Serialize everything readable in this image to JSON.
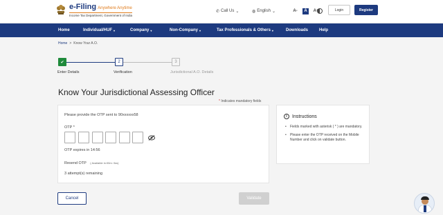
{
  "header": {
    "logo_main": "e-Filing",
    "logo_hindi": "Anywhere Anytime",
    "logo_sub": "Income Tax Department, Government of India",
    "call_us": "Call Us",
    "language": "English",
    "font_sizes": [
      "A-",
      "A",
      "A+"
    ],
    "login_label": "Login",
    "register_label": "Register",
    "brand_color": "#1d3a7f"
  },
  "nav": {
    "items": [
      {
        "label": "Home",
        "dropdown": false
      },
      {
        "label": "Individual/HUF",
        "dropdown": true
      },
      {
        "label": "Company",
        "dropdown": true
      },
      {
        "label": "Non-Company",
        "dropdown": true
      },
      {
        "label": "Tax Professionals & Others",
        "dropdown": true
      },
      {
        "label": "Downloads",
        "dropdown": false
      },
      {
        "label": "Help",
        "dropdown": false
      }
    ]
  },
  "breadcrumb": {
    "home": "Home",
    "separator": ">",
    "current": "Know Your A.O."
  },
  "stepper": {
    "steps": [
      {
        "number": "1",
        "label": "Enter Details",
        "state": "done"
      },
      {
        "number": "2",
        "label": "Verification",
        "state": "active"
      },
      {
        "number": "3",
        "label": "Jurisdictional A.O. Details",
        "state": "pending"
      }
    ]
  },
  "page": {
    "title": "Know Your Jurisdictional Assessing Officer",
    "mandatory_star": "*",
    "mandatory_note": "Indicates mandatory fields"
  },
  "otp_card": {
    "prompt_prefix": "Please provide the OTP sent to",
    "masked_number": "90xxxxxx58",
    "otp_label": "OTP",
    "otp_required_star": "*",
    "otp_digits": [
      "",
      "",
      "",
      "",
      "",
      ""
    ],
    "expires_text": "OTP expires in 14:56",
    "resend_label": "Resend OTP",
    "resend_hint": "( Available in:00m: 0ss)",
    "attempts": "3 attempt(s) remaining"
  },
  "instructions": {
    "title": "Instructions",
    "items": [
      "Fields marked with asterisk ( * ) are mandatory.",
      "Please enter the OTP received on the Mobile Number and click on validate button."
    ]
  },
  "actions": {
    "cancel_label": "Cancel",
    "validate_label": "Validate"
  }
}
